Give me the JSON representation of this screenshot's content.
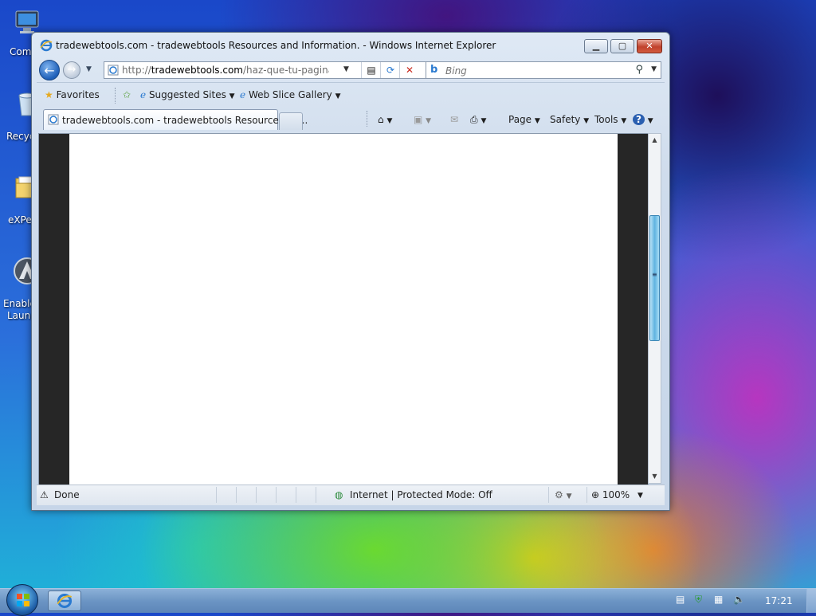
{
  "desktop": {
    "icons": [
      {
        "label": "Com",
        "icon": "computer-icon"
      },
      {
        "label": "Recyc",
        "icon": "recycle-bin-icon"
      },
      {
        "label": "eXPer",
        "icon": "folder-icon"
      },
      {
        "label": "Enable",
        "label2": "Launc",
        "icon": "launcher-icon"
      }
    ]
  },
  "window": {
    "title": "tradewebtools.com - tradewebtools Resources and Information. - Windows Internet Explorer",
    "address": {
      "prefix": "http://",
      "domain": "tradewebtools.com",
      "path": "/haz-que-tu-pagina-web-t"
    },
    "search": {
      "placeholder": "Bing"
    },
    "favorites_bar": {
      "favorites": "Favorites",
      "suggested_sites": "Suggested Sites",
      "web_slice_gallery": "Web Slice Gallery"
    },
    "tab": {
      "title": "tradewebtools.com - tradewebtools Resources an..."
    },
    "command_bar": {
      "page": "Page",
      "safety": "Safety",
      "tools": "Tools"
    },
    "status": {
      "text": "Done",
      "zone": "Internet | Protected Mode: Off",
      "zoom": "100%"
    }
  },
  "taskbar": {
    "clock": "17:21"
  },
  "colors": {
    "accent": "#1e5fb8",
    "close_button": "#c1422d",
    "scroll_thumb": "#5fb3e0"
  }
}
